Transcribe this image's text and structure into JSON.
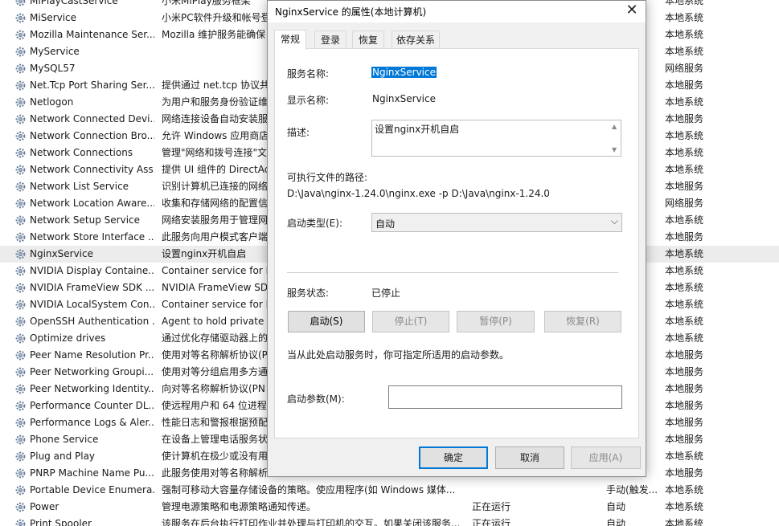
{
  "services": [
    {
      "name": "MiPlayCastService",
      "desc": "小米MiPlay服务框架",
      "status": "",
      "startup": "",
      "logon": "本地系统"
    },
    {
      "name": "MiService",
      "desc": "小米PC软件升级和帐号登",
      "status": "",
      "startup": "",
      "logon": "本地系统"
    },
    {
      "name": "Mozilla Maintenance Ser...",
      "desc": "Mozilla 维护服务能确保",
      "status": "",
      "startup": "",
      "logon": "本地系统"
    },
    {
      "name": "MyService",
      "desc": "",
      "status": "",
      "startup": "",
      "logon": "本地系统"
    },
    {
      "name": "MySQL57",
      "desc": "",
      "status": "",
      "startup": "",
      "logon": "网络服务"
    },
    {
      "name": "Net.Tcp Port Sharing Ser...",
      "desc": "提供通过 net.tcp 协议共",
      "status": "",
      "startup": "",
      "logon": "本地服务"
    },
    {
      "name": "Netlogon",
      "desc": "为用户和服务身份验证维",
      "status": "",
      "startup": "",
      "logon": "本地系统"
    },
    {
      "name": "Network Connected Devi...",
      "desc": "网络连接设备自动安装服",
      "status": "",
      "startup": "",
      "logon": "本地服务"
    },
    {
      "name": "Network Connection Bro...",
      "desc": "允许 Windows 应用商店",
      "status": "",
      "startup": "",
      "logon": "本地系统"
    },
    {
      "name": "Network Connections",
      "desc": "管理\"网络和拨号连接\"文",
      "status": "",
      "startup": "",
      "logon": "本地系统"
    },
    {
      "name": "Network Connectivity Ass...",
      "desc": "提供 UI 组件的 DirectAc",
      "status": "",
      "startup": "",
      "logon": "本地系统"
    },
    {
      "name": "Network List Service",
      "desc": "识别计算机已连接的网络",
      "status": "",
      "startup": "",
      "logon": "本地服务"
    },
    {
      "name": "Network Location Aware...",
      "desc": "收集和存储网络的配置信",
      "status": "",
      "startup": "",
      "logon": "网络服务"
    },
    {
      "name": "Network Setup Service",
      "desc": "网络安装服务用于管理网",
      "status": "",
      "startup": "",
      "logon": "本地系统"
    },
    {
      "name": "Network Store Interface ...",
      "desc": "此服务向用户模式客户端",
      "status": "",
      "startup": "",
      "logon": "本地服务"
    },
    {
      "name": "NginxService",
      "desc": "设置nginx开机自启",
      "status": "",
      "startup": "",
      "logon": "本地系统"
    },
    {
      "name": "NVIDIA Display Containe...",
      "desc": "Container service for N",
      "status": "",
      "startup": "",
      "logon": "本地系统"
    },
    {
      "name": "NVIDIA FrameView SDK ...",
      "desc": "NVIDIA FrameView SD",
      "status": "",
      "startup": "",
      "logon": "本地系统"
    },
    {
      "name": "NVIDIA LocalSystem Con...",
      "desc": "Container service for N",
      "status": "",
      "startup": "",
      "logon": "本地系统"
    },
    {
      "name": "OpenSSH Authentication ...",
      "desc": "Agent to hold private",
      "status": "",
      "startup": "",
      "logon": "本地系统"
    },
    {
      "name": "Optimize drives",
      "desc": "通过优化存储驱动器上的",
      "status": "",
      "startup": "",
      "logon": "本地系统"
    },
    {
      "name": "Peer Name Resolution Pr...",
      "desc": "使用对等名称解析协议(P",
      "status": "",
      "startup": "",
      "logon": "本地服务"
    },
    {
      "name": "Peer Networking Groupi...",
      "desc": "使用对等分组启用多方通",
      "status": "",
      "startup": "",
      "logon": "本地服务"
    },
    {
      "name": "Peer Networking Identity...",
      "desc": "向对等名称解析协议(PN",
      "status": "",
      "startup": "",
      "logon": "本地服务"
    },
    {
      "name": "Performance Counter DL...",
      "desc": "使远程用户和 64 位进程",
      "status": "",
      "startup": "",
      "logon": "本地服务"
    },
    {
      "name": "Performance Logs & Aler...",
      "desc": "性能日志和警报根据预配",
      "status": "",
      "startup": "",
      "logon": "本地服务"
    },
    {
      "name": "Phone Service",
      "desc": "在设备上管理电话服务状",
      "status": "",
      "startup": "",
      "logon": "本地服务"
    },
    {
      "name": "Plug and Play",
      "desc": "使计算机在极少或没有用",
      "status": "",
      "startup": "",
      "logon": "本地系统"
    },
    {
      "name": "PNRP Machine Name Pu...",
      "desc": "此服务使用对等名称解析",
      "status": "",
      "startup": "",
      "logon": "本地服务"
    },
    {
      "name": "Portable Device Enumera...",
      "desc": "强制可移动大容量存储设备的策略。使应用程序(如 Windows 媒体...",
      "status": "",
      "startup": "手动(触发...",
      "logon": "本地系统"
    },
    {
      "name": "Power",
      "desc": "管理电源策略和电源策略通知传递。",
      "status": "正在运行",
      "startup": "自动",
      "logon": "本地系统"
    },
    {
      "name": "Print Spooler",
      "desc": "该服务在后台执行打印作业并处理与打印机的交互。如果关闭该服务...",
      "status": "正在运行",
      "startup": "自动",
      "logon": "本地系统"
    }
  ],
  "dialog": {
    "title": "NginxService 的属性(本地计算机)",
    "close_symbol": "✕",
    "tabs": [
      "常规",
      "登录",
      "恢复",
      "依存关系"
    ],
    "service_name_label": "服务名称:",
    "service_name": "NginxService",
    "display_name_label": "显示名称:",
    "display_name": "NginxService",
    "description_label": "描述:",
    "description": "设置nginx开机自启",
    "exe_path_label": "可执行文件的路径:",
    "exe_path": "D:\\Java\\nginx-1.24.0\\nginx.exe -p D:\\Java\\nginx-1.24.0",
    "startup_type_label": "启动类型(E):",
    "startup_type": "自动",
    "service_status_label": "服务状态:",
    "service_status": "已停止",
    "buttons": {
      "start": "启动(S)",
      "stop": "停止(T)",
      "pause": "暂停(P)",
      "resume": "恢复(R)"
    },
    "hint": "当从此处启动服务时，你可指定所适用的启动参数。",
    "start_params_label": "启动参数(M):",
    "start_params_value": "",
    "ok": "确定",
    "cancel": "取消",
    "apply": "应用(A)"
  }
}
